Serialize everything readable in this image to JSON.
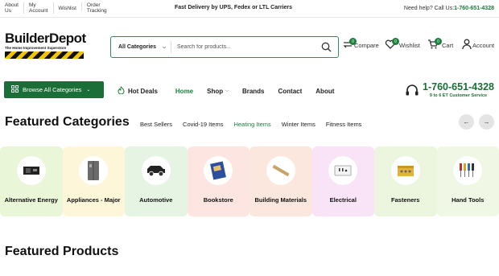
{
  "topbar": {
    "links": [
      {
        "label": "About Us",
        "lines": [
          "About",
          "Us"
        ]
      },
      {
        "label": "My Account",
        "lines": [
          "My",
          "Account"
        ]
      },
      {
        "label": "Wishlist",
        "lines": [
          "Wishlist"
        ]
      },
      {
        "label": "Order Tracking",
        "lines": [
          "Order",
          "Tracking"
        ]
      }
    ],
    "center": "Fast Delivery by UPS, Fedex or LTL Carriers",
    "help_text": "Need help? Call Us:",
    "help_phone": "1-760-651-4328"
  },
  "header": {
    "logo_main": "BuilderDepot",
    "logo_sub": "The Home Improvement Superstore",
    "search": {
      "category": "All Categories",
      "placeholder": "Search for products..."
    },
    "compare": {
      "label": "Compare",
      "count": "0"
    },
    "wishlist": {
      "label": "Wishlist",
      "count": "0"
    },
    "cart": {
      "label": "Cart",
      "count": "0"
    },
    "account": {
      "label": "Account"
    }
  },
  "nav": {
    "browse": "Browse All Categories",
    "hot_deals": "Hot Deals",
    "items": [
      {
        "label": "Home",
        "active": true
      },
      {
        "label": "Shop",
        "dropdown": true
      },
      {
        "label": "Brands"
      },
      {
        "label": "Contact"
      },
      {
        "label": "About"
      }
    ],
    "phone": "1-760-651-4328",
    "hours": "9 to 6 ET Customer Service"
  },
  "featured_categories": {
    "title": "Featured Categories",
    "tabs": [
      "Best Sellers",
      "Covid-19 Items",
      "Heating Items",
      "Winter Items",
      "Fitness Items"
    ],
    "active_tab": "Heating Items",
    "items": [
      {
        "label": "Alternative Energy",
        "bg": "#e9f6d8",
        "icon": "generator-icon"
      },
      {
        "label": "Appliances - Major",
        "bg": "#fdf6d9",
        "icon": "refrigerator-icon"
      },
      {
        "label": "Automotive",
        "bg": "#e6f5e3",
        "icon": "truck-icon"
      },
      {
        "label": "Bookstore",
        "bg": "#fde6e1",
        "icon": "book-icon"
      },
      {
        "label": "Building Materials",
        "bg": "#fbe7dd",
        "icon": "lumber-icon"
      },
      {
        "label": "Electrical",
        "bg": "#f9e3f7",
        "icon": "outlet-icon"
      },
      {
        "label": "Fasteners",
        "bg": "#ecf6df",
        "icon": "fastener-kit-icon"
      },
      {
        "label": "Hand Tools",
        "bg": "#f0f7e4",
        "icon": "screwdriver-set-icon"
      }
    ]
  },
  "featured_products": {
    "title": "Featured Products"
  },
  "colors": {
    "brand_green": "#1b6e37",
    "accent_green": "#1b7f3e",
    "logo_yellow": "#f2c30b"
  }
}
